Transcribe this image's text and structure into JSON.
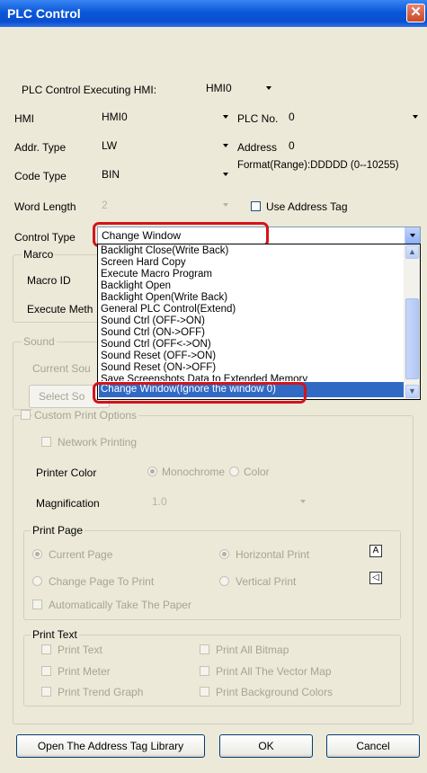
{
  "window": {
    "title": "PLC Control",
    "close_glyph": "✕"
  },
  "form": {
    "exec_hmi_label": "PLC Control Executing HMI:",
    "exec_hmi_value": "HMI0",
    "hmi_label": "HMI",
    "hmi_value": "HMI0",
    "plc_no_label": "PLC No.",
    "plc_no_value": "0",
    "addr_type_label": "Addr. Type",
    "addr_type_value": "LW",
    "address_label": "Address",
    "address_value": "0",
    "code_type_label": "Code Type",
    "code_type_value": "BIN",
    "format_text": "Format(Range):DDDDD (0--10255)",
    "word_length_label": "Word Length",
    "word_length_value": "2",
    "use_address_tag_label": "Use Address Tag",
    "control_type_label": "Control Type",
    "control_type_value": "Change Window"
  },
  "dropdown": {
    "items": [
      "Backlight Close(Write Back)",
      "Screen Hard Copy",
      "Execute Macro Program",
      "Backlight Open",
      "Backlight Open(Write Back)",
      "General PLC Control(Extend)",
      "Sound Ctrl (OFF->ON)",
      "Sound Ctrl (ON->OFF)",
      "Sound Ctrl (OFF<->ON)",
      "Sound Reset (OFF->ON)",
      "Sound Reset (ON->OFF)",
      "Save Screenshots Data to Extended Memory",
      "Change Window(Ignore the window 0)"
    ],
    "selected_index": 12
  },
  "macro": {
    "legend": "Marco",
    "macro_id_label": "Macro ID",
    "exec_method_label": "Execute Meth"
  },
  "sound": {
    "legend": "Sound",
    "current_label": "Current Sou",
    "select_button": "Select So"
  },
  "custom_print": {
    "label": "Custom Print Options",
    "network_printing": "Network Printing",
    "printer_color_label": "Printer Color",
    "monochrome": "Monochrome",
    "color": "Color",
    "magnification_label": "Magnification",
    "magnification_value": "1.0"
  },
  "print_page": {
    "legend": "Print Page",
    "current_page": "Current Page",
    "horizontal_print": "Horizontal Print",
    "change_page": "Change Page To Print",
    "vertical_print": "Vertical Print",
    "auto_take_paper": "Automatically Take The Paper"
  },
  "print_text": {
    "legend": "Print Text",
    "print_text": "Print Text",
    "print_all_bitmap": "Print All Bitmap",
    "print_meter": "Print Meter",
    "print_all_vector": "Print All The Vector Map",
    "print_trend": "Print Trend Graph",
    "print_bg_colors": "Print Background Colors"
  },
  "buttons": {
    "open_tag_library": "Open The Address Tag Library",
    "ok": "OK",
    "cancel": "Cancel"
  },
  "icons": {
    "horizontal": "A",
    "vertical": "◁"
  },
  "colors": {
    "title_bar": "#0a58d8",
    "selection": "#316ac5",
    "highlight_box": "#d4141a",
    "dialog_bg": "#ece9d8"
  }
}
